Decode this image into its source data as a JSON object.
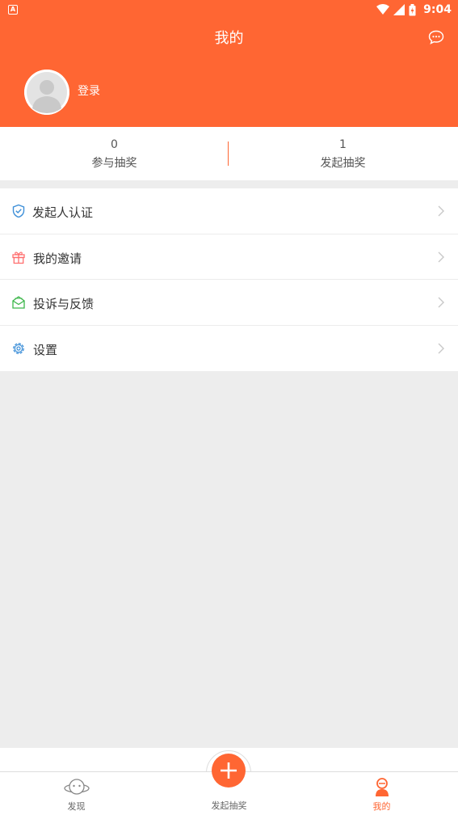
{
  "status_bar": {
    "time": "9:04",
    "app_icon": "A"
  },
  "header": {
    "title": "我的",
    "login_label": "登录",
    "message_icon": "chat-bubble-icon"
  },
  "stats": [
    {
      "count": "0",
      "label": "参与抽奖"
    },
    {
      "count": "1",
      "label": "发起抽奖"
    }
  ],
  "menu": [
    {
      "label": "发起人认证",
      "icon": "shield-check-icon",
      "color": "#3d8fd8"
    },
    {
      "label": "我的邀请",
      "icon": "gift-icon",
      "color": "#ff6f6f"
    },
    {
      "label": "投诉与反馈",
      "icon": "mail-icon",
      "color": "#3cb64a"
    },
    {
      "label": "设置",
      "icon": "gear-icon",
      "color": "#3d8fd8"
    }
  ],
  "tabbar": {
    "discover_label": "发现",
    "create_label": "发起抽奖",
    "mine_label": "我的"
  },
  "colors": {
    "accent": "#ff6633",
    "background": "#ededed"
  }
}
